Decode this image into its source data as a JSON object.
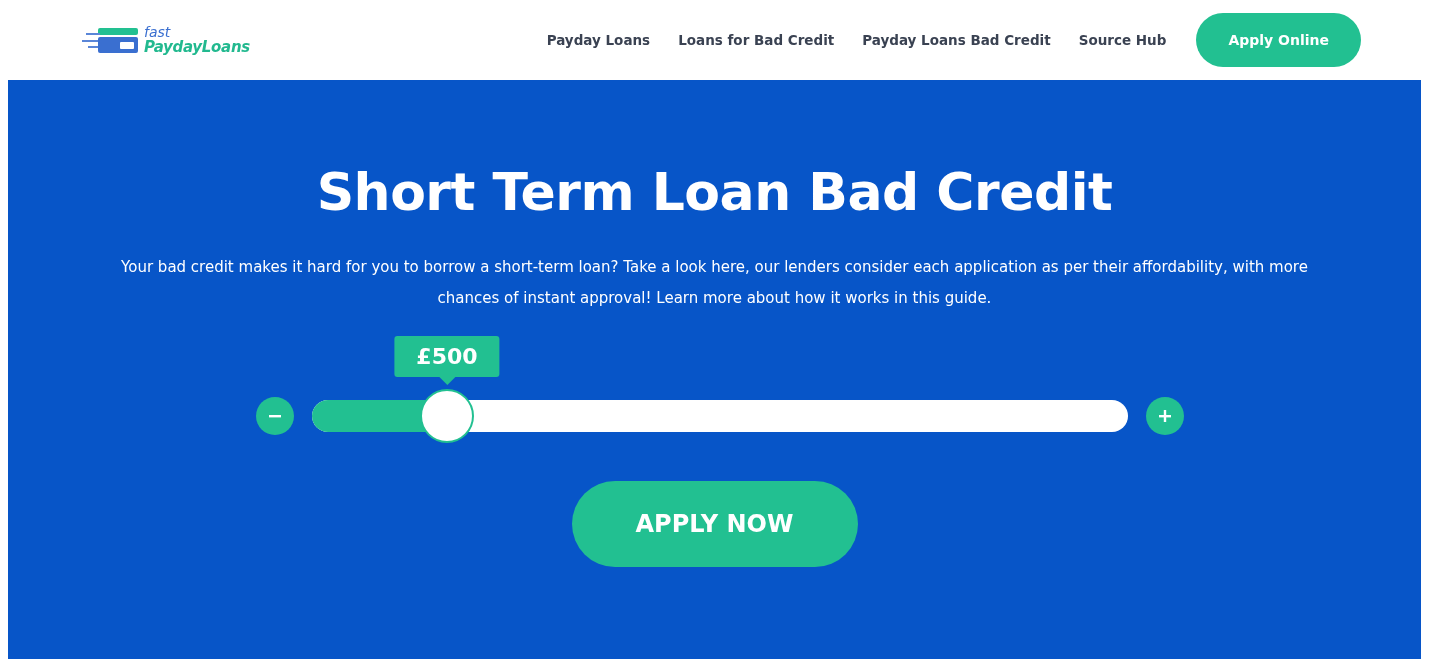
{
  "logo": {
    "line_1": "fast",
    "line_2": "PaydayLoans"
  },
  "nav": {
    "links": [
      "Payday Loans",
      "Loans for Bad Credit",
      "Payday Loans Bad Credit",
      "Source Hub"
    ],
    "cta": "Apply Online"
  },
  "hero": {
    "title": "Short Term Loan Bad Credit",
    "text": "Your bad credit makes it hard for you to borrow a short-term loan? Take a look here, our lenders consider each application as per their affordability, with more chances of instant approval! Learn more about how it works in this guide.",
    "slider": {
      "reading": "£500",
      "level": 0.166
    },
    "button": "APPLY NOW"
  }
}
